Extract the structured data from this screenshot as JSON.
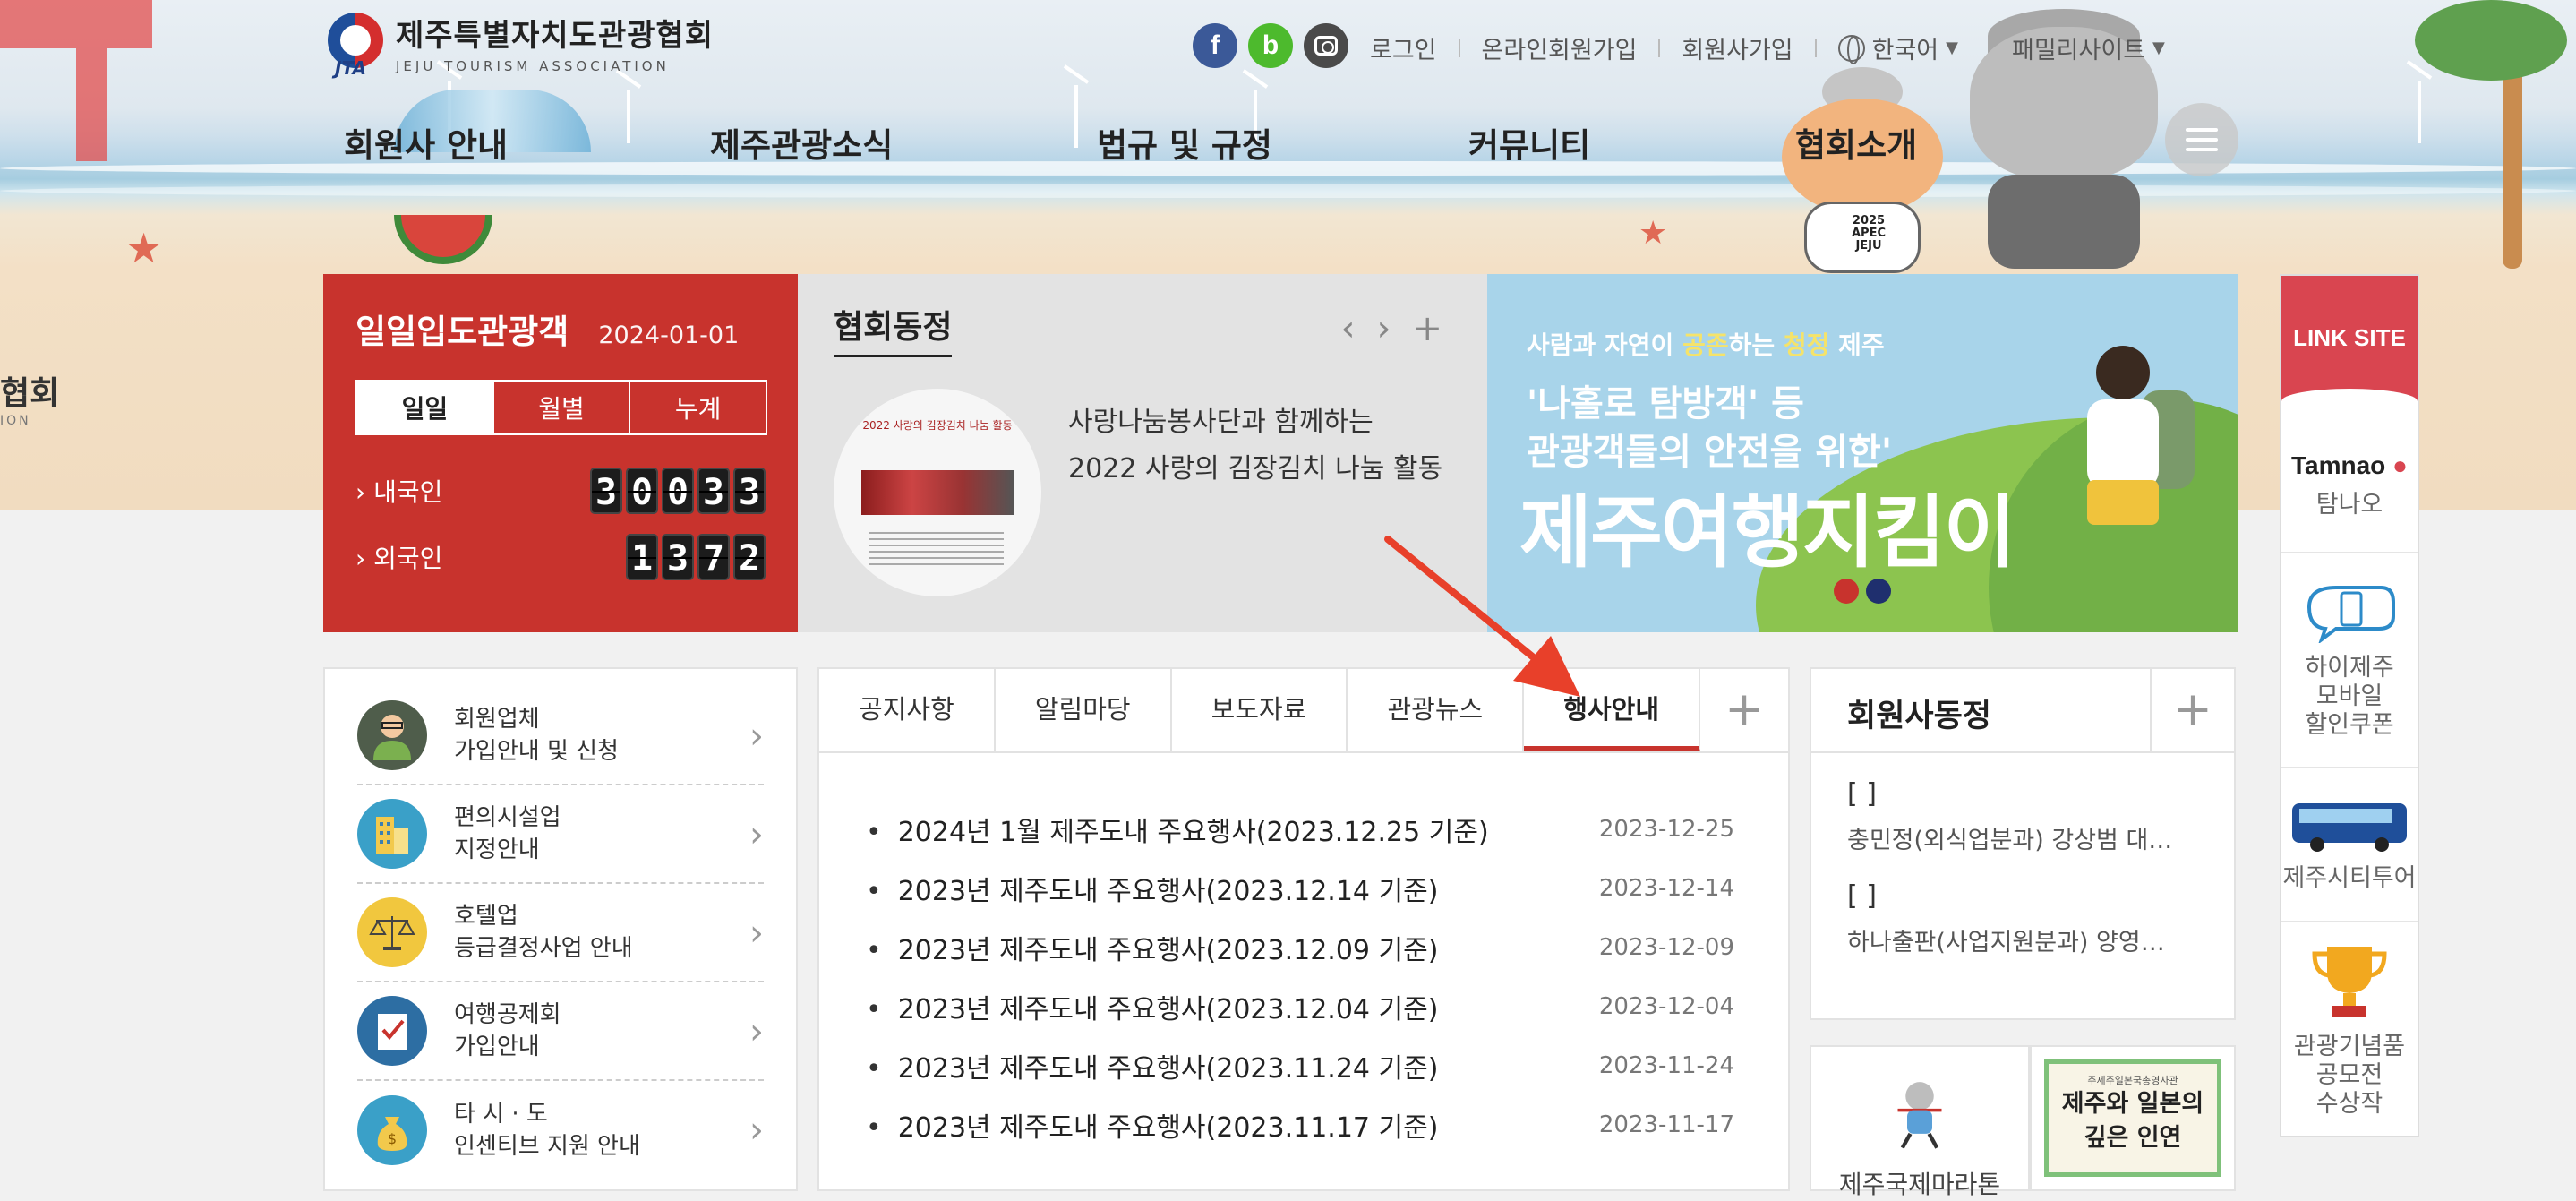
{
  "header": {
    "logo_name": "제주특별자치도관광협회",
    "logo_sub": "JEJU TOURISM ASSOCIATION",
    "logo_mark": "JTA",
    "side_text": "협회",
    "side_text_sub": "ION"
  },
  "socials": [
    {
      "name": "facebook",
      "glyph": "f"
    },
    {
      "name": "blog",
      "glyph": "b"
    },
    {
      "name": "instagram",
      "glyph": ""
    }
  ],
  "util_nav": {
    "login": "로그인",
    "online_join": "온라인회원가입",
    "member_join": "회원사가입",
    "language": "한국어",
    "family_site": "패밀리사이트"
  },
  "gnb": [
    "회원사 안내",
    "제주관광소식",
    "법규 및 규정",
    "커뮤니티",
    "협회소개"
  ],
  "mascot_badge": "2025\nAPEC\nJEJU",
  "stats": {
    "title": "일일입도관광객",
    "date": "2024-01-01",
    "tabs": [
      "일일",
      "월별",
      "누계"
    ],
    "domestic_label": "› 내국인",
    "domestic_value": "30033",
    "foreign_label": "› 외국인",
    "foreign_value": "1372"
  },
  "assoc_news": {
    "title": "협회동정",
    "thumb_caption": "2022 사랑의 김장김치 나눔 활동",
    "line1": "사랑나눔봉사단과 함께하는",
    "line2": "2022 사랑의 김장김치 나눔 활동"
  },
  "banner": {
    "tagline_pre": "사람과 자연이 ",
    "tagline_hl1": "공존",
    "tagline_mid": "하는 ",
    "tagline_hl2": "청정",
    "tagline_post": " 제주",
    "line1": "'나홀로 탐방객' 등",
    "line2": "관광객들의 안전을 위한'",
    "headline": "제주여행지킴이",
    "dot_colors": [
      "#c8332d",
      "#1f2f6e"
    ]
  },
  "link_site": {
    "title": "LINK SITE",
    "items": [
      {
        "label": "탐나오",
        "logo": "Tamnao"
      },
      {
        "label": "하이제주\n모바일\n할인쿠폰"
      },
      {
        "label": "제주시티투어"
      },
      {
        "label": "관광기념품\n공모전\n수상작"
      }
    ]
  },
  "quick_menu": [
    {
      "line1": "회원업체",
      "line2": "가입안내 및 신청",
      "icon": "person-icon",
      "color": "#4f5d4b"
    },
    {
      "line1": "편의시설업",
      "line2": "지정안내",
      "icon": "building-icon",
      "color": "#3aa0c8"
    },
    {
      "line1": "호텔업",
      "line2": "등급결정사업 안내",
      "icon": "scale-icon",
      "color": "#f1c73e"
    },
    {
      "line1": "여행공제회",
      "line2": "가입안내",
      "icon": "checklist-icon",
      "color": "#2d6ea3"
    },
    {
      "line1": "타 시 · 도",
      "line2": "인센티브 지원 안내",
      "icon": "moneybag-icon",
      "color": "#3aa0c8"
    }
  ],
  "notice": {
    "tabs": [
      "공지사항",
      "알림마당",
      "보도자료",
      "관광뉴스",
      "행사안내"
    ],
    "active_tab": "행사안내",
    "items": [
      {
        "title": "2024년 1월 제주도내 주요행사(2023.12.25 기준)",
        "date": "2023-12-25"
      },
      {
        "title": "2023년 제주도내 주요행사(2023.12.14 기준)",
        "date": "2023-12-14"
      },
      {
        "title": "2023년 제주도내 주요행사(2023.12.09 기준)",
        "date": "2023-12-09"
      },
      {
        "title": "2023년 제주도내 주요행사(2023.12.04 기준)",
        "date": "2023-12-04"
      },
      {
        "title": "2023년 제주도내 주요행사(2023.11.24 기준)",
        "date": "2023-11-24"
      },
      {
        "title": "2023년 제주도내 주요행사(2023.11.17 기준)",
        "date": "2023-11-17"
      }
    ]
  },
  "member_news": {
    "title": "회원사동정",
    "items": [
      {
        "bracket": "[ ]",
        "text": "충민정(외식업분과) 강상범 대…"
      },
      {
        "bracket": "[ ]",
        "text": "하나출판(사업지원분과) 양영…"
      }
    ]
  },
  "bottom_banners": {
    "marathon": "제주국제마라톤",
    "exhibit_sub": "주제주일본국총영사관",
    "exhibit_line1": "제주와 일본의",
    "exhibit_line2": "깊은 인연"
  },
  "colors": {
    "brand_red": "#c8332d",
    "annotation_arrow": "#e8402a"
  }
}
